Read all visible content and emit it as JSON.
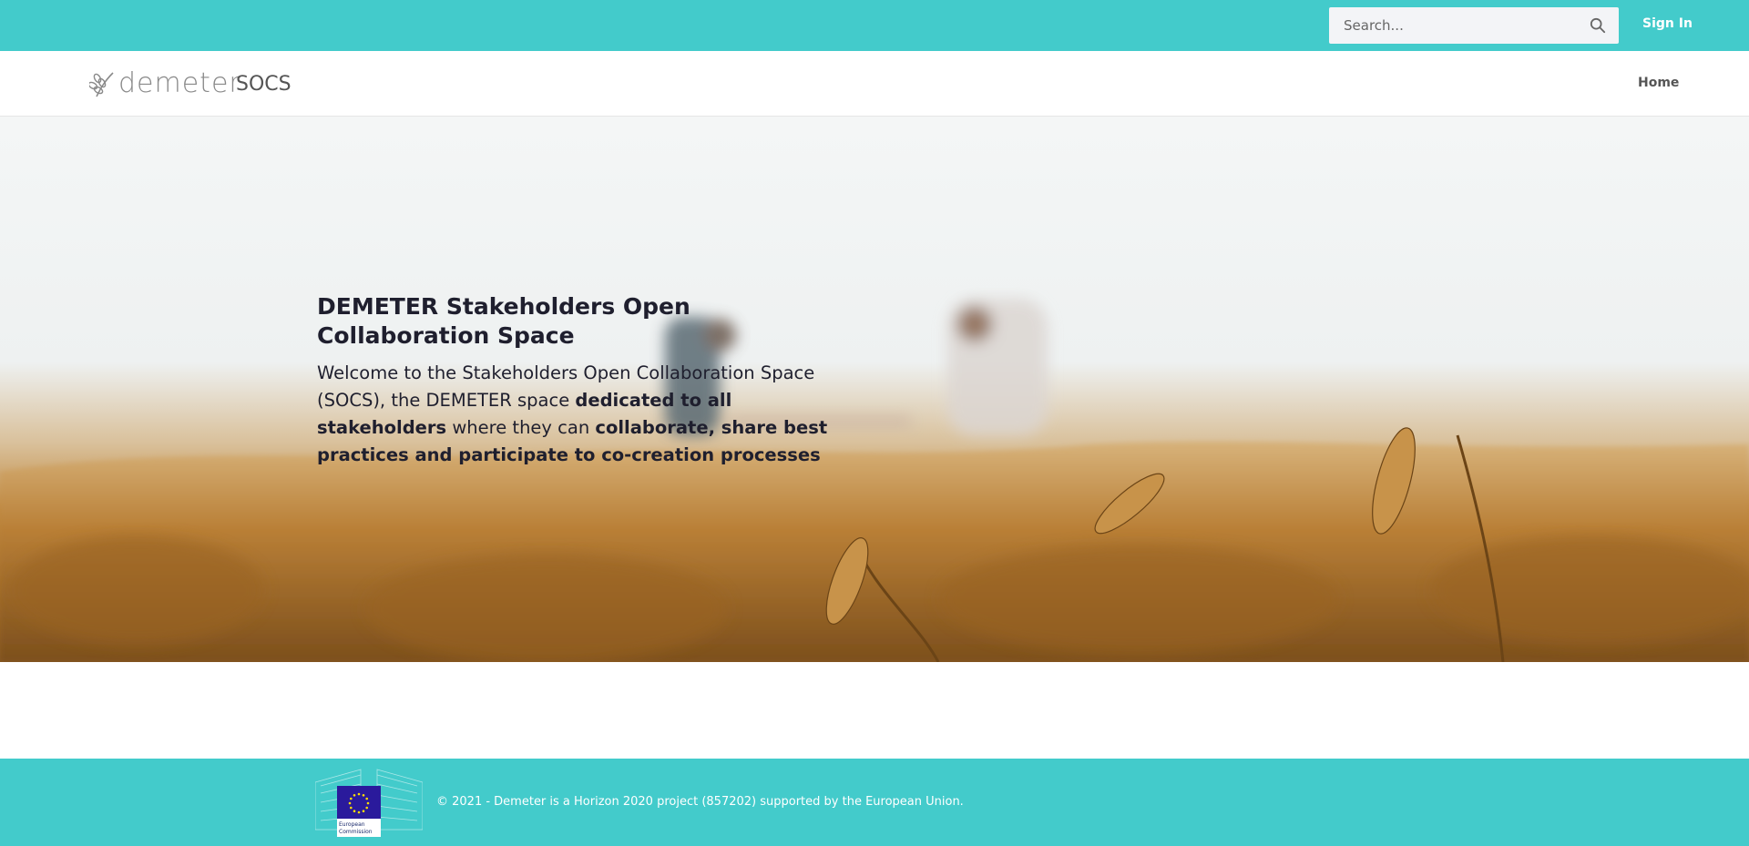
{
  "topbar": {
    "search_placeholder": "Search...",
    "search_icon": "search-icon",
    "signin_label": "Sign In"
  },
  "navbar": {
    "logo_text": "demeter",
    "brand": "SOCS",
    "home_label": "Home"
  },
  "hero": {
    "title": "DEMETER Stakeholders Open Collaboration Space",
    "body_1": "Welcome to the Stakeholders Open Collaboration Space (SOCS), the DEMETER space ",
    "body_bold_1": "dedicated to all stakeholders",
    "body_2": " where they can ",
    "body_bold_2": "collaborate, share best practices and participate to co-creation processes"
  },
  "footer": {
    "eu_label_1": "European",
    "eu_label_2": "Commission",
    "copyright": "© 2021 - Demeter is a Horizon 2020 project (857202) supported by the European Union."
  },
  "colors": {
    "accent": "#43cbcb",
    "text_dark": "#1f1f2e",
    "eu_blue": "#2a1a9c",
    "eu_yellow": "#ffde00"
  }
}
